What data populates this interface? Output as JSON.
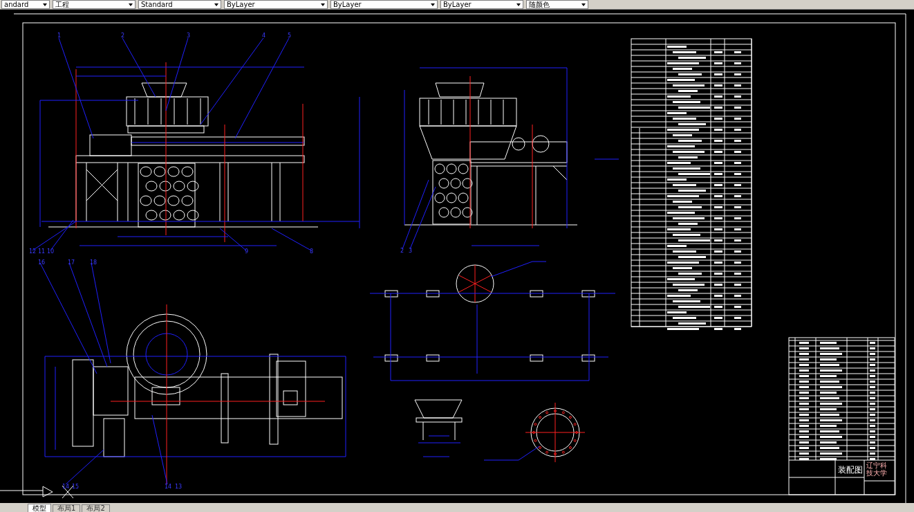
{
  "toolbar": {
    "dropdowns": [
      {
        "value": "andard"
      },
      {
        "value": "工程"
      },
      {
        "value": "Standard"
      },
      {
        "value": "ByLayer"
      },
      {
        "value": "ByLayer"
      },
      {
        "value": "ByLayer"
      },
      {
        "value": "随颜色"
      }
    ]
  },
  "drawing": {
    "part_numbers": [
      "1",
      "2",
      "3",
      "4",
      "5",
      "12",
      "11",
      "10",
      "9",
      "8",
      "2",
      "3",
      "16",
      "17",
      "18",
      "14",
      "15",
      "14",
      "13"
    ]
  },
  "title_block": {
    "title": "装配图",
    "school": "辽宁科技大学"
  },
  "tabs": [
    {
      "label": "模型",
      "selected": true
    },
    {
      "label": "布局1",
      "selected": false
    },
    {
      "label": "布局2",
      "selected": false
    }
  ]
}
